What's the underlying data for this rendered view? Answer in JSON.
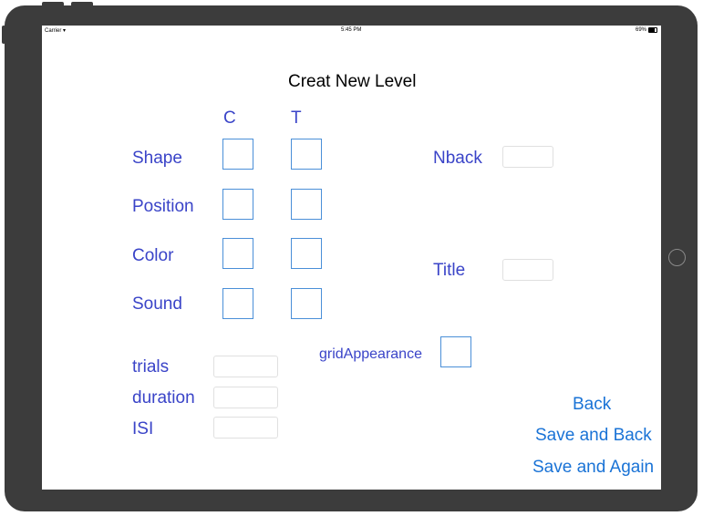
{
  "status_bar": {
    "carrier": "Carrier",
    "wifi_icon": "wifi-icon",
    "time": "5:45 PM",
    "battery": "69%",
    "battery_level": 0.69
  },
  "page": {
    "title": "Creat New Level"
  },
  "columns": {
    "c": "C",
    "t": "T"
  },
  "rows": [
    {
      "label": "Shape"
    },
    {
      "label": "Position"
    },
    {
      "label": "Color"
    },
    {
      "label": "Sound"
    }
  ],
  "right_fields": {
    "nback": "Nback",
    "title": "Title"
  },
  "grid_appearance": "gridAppearance",
  "timing": {
    "trials": "trials",
    "duration": "duration",
    "isi": "ISI"
  },
  "buttons": {
    "back": "Back",
    "save_and_back": "Save and Back",
    "save_and_again": "Save and Again"
  },
  "colors": {
    "label_blue": "#3a44c8",
    "button_blue": "#1a73d6",
    "box_border": "#4a8fd8",
    "device_frame": "#3c3c3c"
  }
}
